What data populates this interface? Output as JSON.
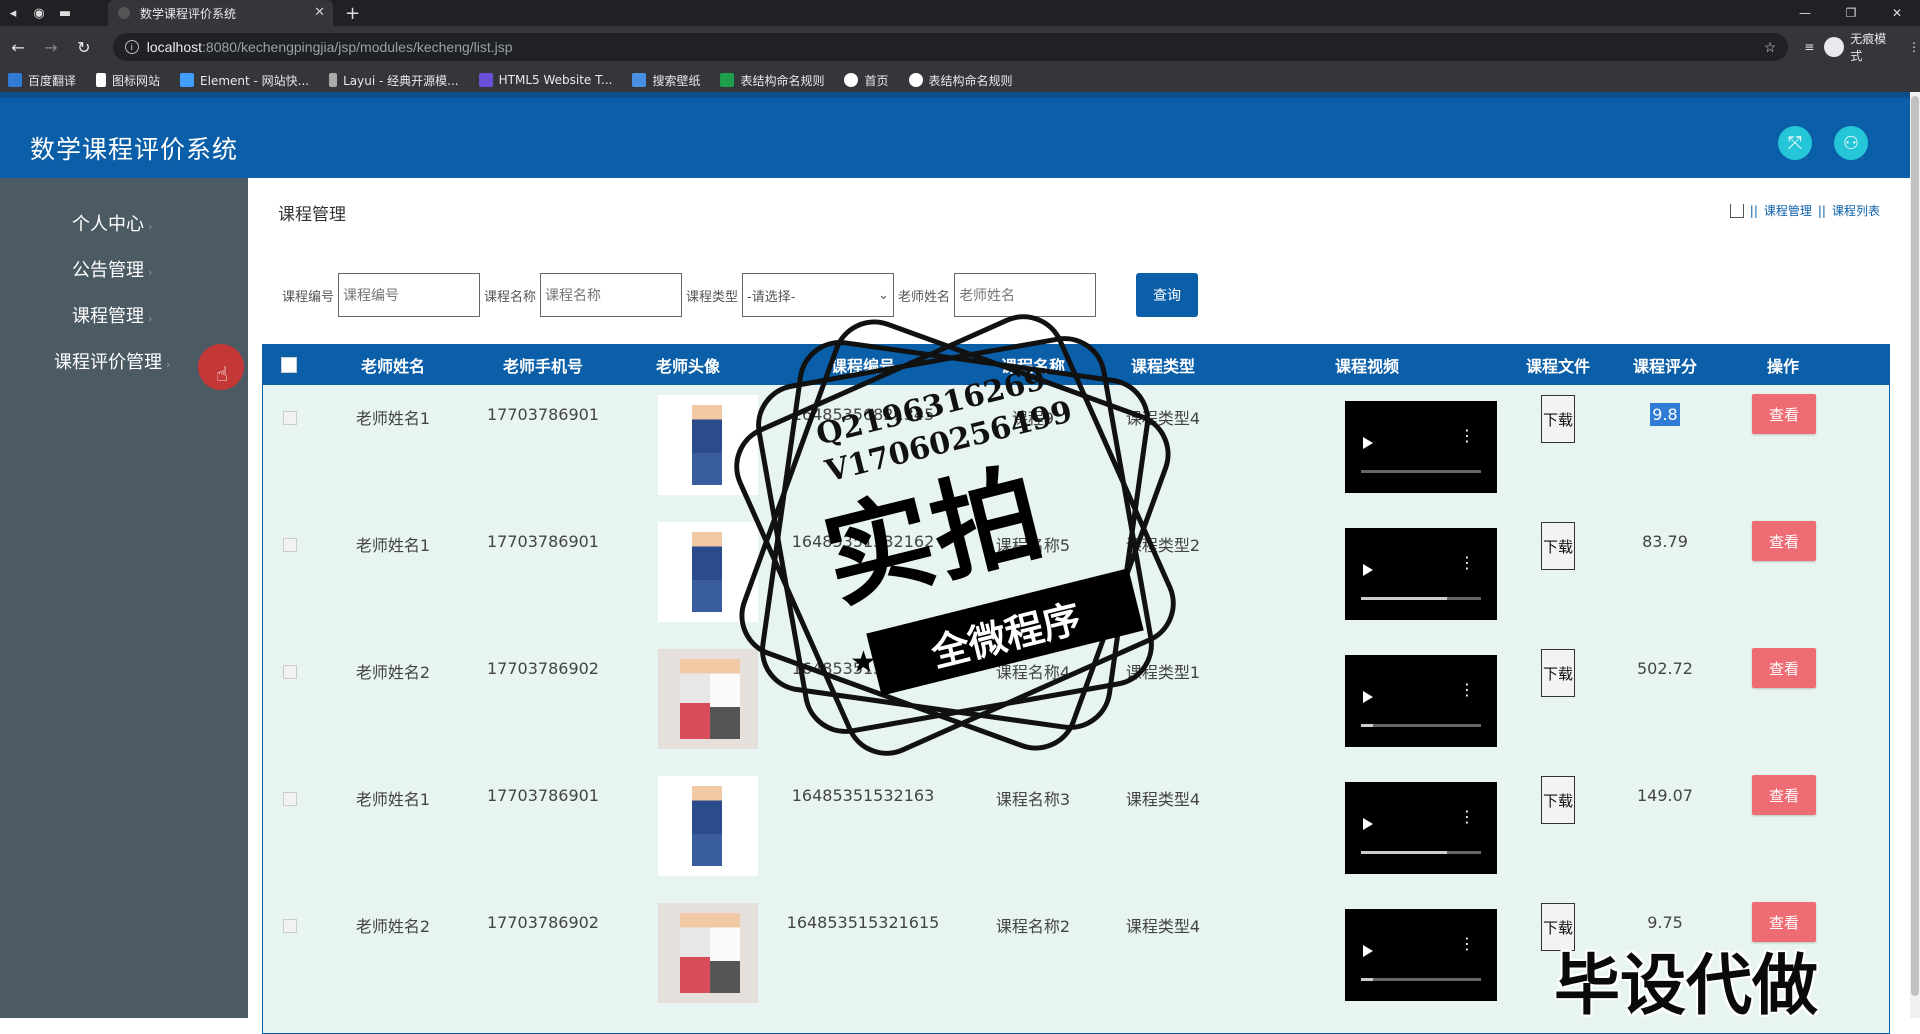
{
  "browser": {
    "tab_title": "数学课程评价系统",
    "url_host": "localhost",
    "url_rest": ":8080/kechengpingjia/jsp/modules/kecheng/list.jsp",
    "incognito_label": "无痕模式",
    "bookmarks": [
      "百度翻译",
      "图标网站",
      "Element - 网站快...",
      "Layui - 经典开源模...",
      "HTML5 Website T...",
      "搜索壁纸",
      "表结构命名规则",
      "首页",
      "表结构命名规则"
    ]
  },
  "app": {
    "title": "数学课程评价系统",
    "accent": "#0b5ea8",
    "sidebar": {
      "items": [
        {
          "label": "个人中心"
        },
        {
          "label": "公告管理"
        },
        {
          "label": "课程管理"
        },
        {
          "label": "课程评价管理"
        }
      ]
    },
    "page_title": "课程管理",
    "breadcrumb": [
      "课程管理",
      "课程列表"
    ],
    "search": {
      "code_label": "课程编号",
      "code_placeholder": "课程编号",
      "name_label": "课程名称",
      "name_placeholder": "课程名称",
      "type_label": "课程类型",
      "type_selected": "-请选择-",
      "teacher_label": "老师姓名",
      "teacher_placeholder": "老师姓名",
      "button": "查询"
    },
    "table": {
      "headers": [
        "老师姓名",
        "老师手机号",
        "老师头像",
        "课程编号",
        "课程名称",
        "课程类型",
        "课程视频",
        "课程文件",
        "课程评分",
        "操作"
      ],
      "download_label": "下载",
      "view_label": "查看",
      "rows": [
        {
          "teacher": "老师姓名1",
          "phone": "17703786901",
          "code": "16485356821345",
          "name": "课程9",
          "type": "课程类型4",
          "score": "9.8",
          "video_progress": 0.0
        },
        {
          "teacher": "老师姓名1",
          "phone": "17703786901",
          "code": "16485351532162",
          "name": "课程名称5",
          "type": "课程类型2",
          "score": "83.79",
          "video_progress": 0.72
        },
        {
          "teacher": "老师姓名2",
          "phone": "17703786902",
          "code": "16485351532161",
          "name": "课程名称4",
          "type": "课程类型1",
          "score": "502.72",
          "video_progress": 0.1
        },
        {
          "teacher": "老师姓名1",
          "phone": "17703786901",
          "code": "16485351532163",
          "name": "课程名称3",
          "type": "课程类型4",
          "score": "149.07",
          "video_progress": 0.72
        },
        {
          "teacher": "老师姓名2",
          "phone": "17703786902",
          "code": "164853515321615",
          "name": "课程名称2",
          "type": "课程类型4",
          "score": "9.75",
          "video_progress": 0.1
        }
      ]
    }
  },
  "watermark": {
    "contact_line1": "Q2196316269",
    "contact_line2": "V17060256499",
    "big": "实拍",
    "ribbon": "全微程序",
    "corner": "毕设代做"
  }
}
